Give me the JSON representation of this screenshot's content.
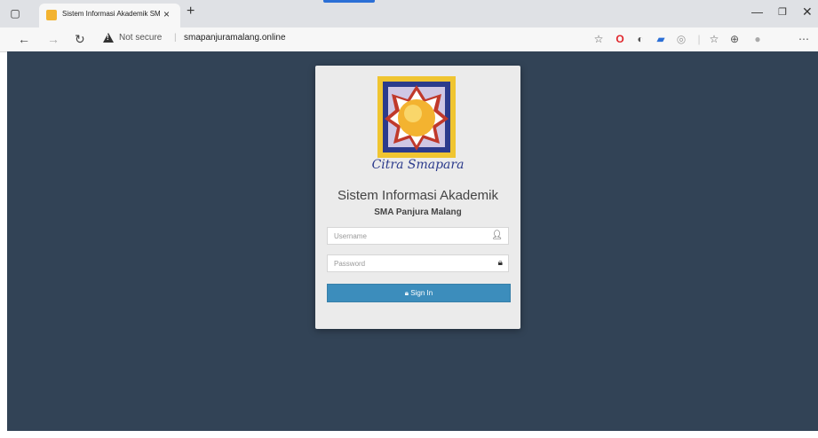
{
  "browser": {
    "tab_title": "Sistem Informasi Akademik SMA",
    "tab_close_glyph": "×",
    "new_tab_glyph": "+",
    "security_label": "Not secure",
    "url": "smapanjuramalang.online",
    "icons": [
      "sidebar-icon",
      "back-icon",
      "forward-icon",
      "reload-icon",
      "warning-icon",
      "favorites-star-icon",
      "opera-icon",
      "extension-icon",
      "extension-icon",
      "extension-icon",
      "favorites-icon",
      "collections-icon",
      "profile-icon",
      "more-icon"
    ]
  },
  "login": {
    "logo_text": "Citra Smapara",
    "title": "Sistem Informasi Akademik",
    "subtitle": "SMA Panjura Malang",
    "username_placeholder": "Username",
    "password_placeholder": "Password",
    "signin_label": "Sign In"
  },
  "colors": {
    "page_bg": "#324356",
    "card_bg": "#ebebeb",
    "button": "#3c8dbc",
    "logo_blue": "#2c3b8c",
    "logo_red": "#c0392b",
    "logo_gold": "#f3b330"
  }
}
